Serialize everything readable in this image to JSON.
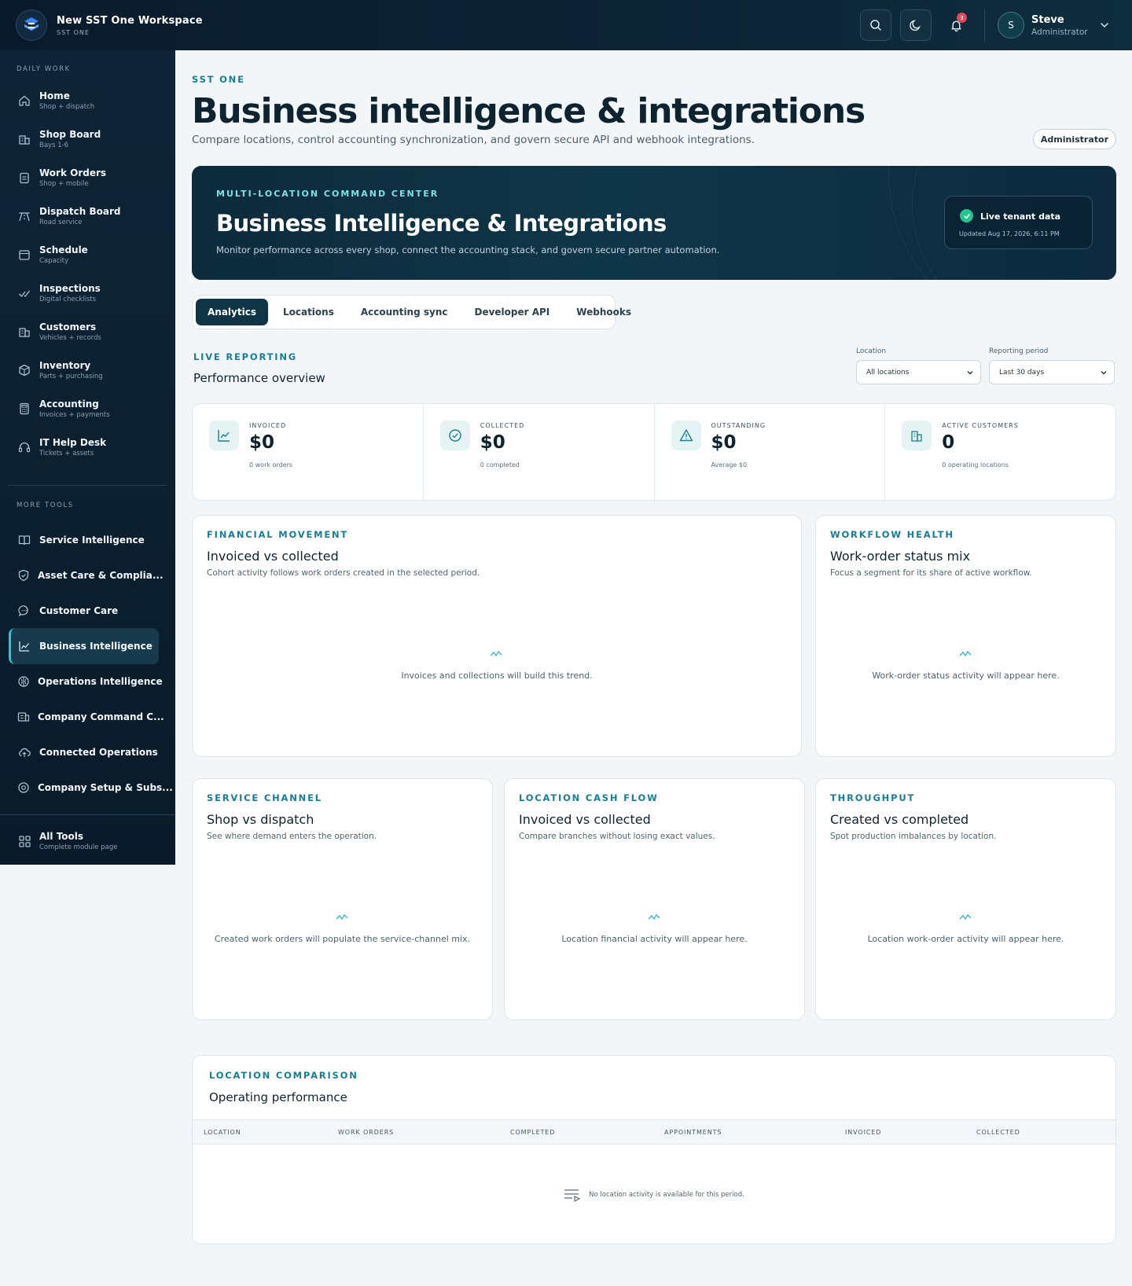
{
  "app": {
    "title": "New SST One Workspace",
    "subtitle": "SST ONE",
    "notifications": "3",
    "user_initial": "S",
    "user_name": "Steve",
    "user_role": "Administrator"
  },
  "sidebar": {
    "daily_label": "DAILY WORK",
    "more_label": "MORE TOOLS",
    "daily": [
      {
        "label": "Home",
        "sub": "Shop + dispatch",
        "icon": "home-icon"
      },
      {
        "label": "Shop Board",
        "sub": "Bays 1-6",
        "icon": "building-icon"
      },
      {
        "label": "Work Orders",
        "sub": "Shop + mobile",
        "icon": "clipboard-icon"
      },
      {
        "label": "Dispatch Board",
        "sub": "Road service",
        "icon": "road-icon"
      },
      {
        "label": "Schedule",
        "sub": "Capacity",
        "icon": "calendar-icon"
      },
      {
        "label": "Inspections",
        "sub": "Digital checklists",
        "icon": "check-icon"
      },
      {
        "label": "Customers",
        "sub": "Vehicles + records",
        "icon": "building-icon"
      },
      {
        "label": "Inventory",
        "sub": "Parts + purchasing",
        "icon": "box-icon"
      },
      {
        "label": "Accounting",
        "sub": "Invoices + payments",
        "icon": "calculator-icon"
      },
      {
        "label": "IT Help Desk",
        "sub": "Tickets + assets",
        "icon": "headset-icon"
      }
    ],
    "more": [
      {
        "label": "Service Intelligence",
        "icon": "book-icon"
      },
      {
        "label": "Asset Care & Complia...",
        "icon": "shield-icon"
      },
      {
        "label": "Customer Care",
        "icon": "chat-icon"
      },
      {
        "label": "Business Intelligence",
        "icon": "chart-icon"
      },
      {
        "label": "Operations Intelligence",
        "icon": "brain-icon"
      },
      {
        "label": "Company Command C...",
        "icon": "command-icon"
      },
      {
        "label": "Connected Operations",
        "icon": "cloud-upload-icon"
      },
      {
        "label": "Company Setup & Subs...",
        "icon": "setup-icon"
      }
    ],
    "all_tools": {
      "label": "All Tools",
      "sub": "Complete module page"
    }
  },
  "page": {
    "eyebrow": "SST ONE",
    "title": "Business intelligence & integrations",
    "subtitle": "Compare locations, control accounting synchronization, and govern secure API and webhook integrations.",
    "role": "Administrator"
  },
  "hero": {
    "eyebrow": "MULTI-LOCATION COMMAND CENTER",
    "title": "Business Intelligence & Integrations",
    "description": "Monitor performance across every shop, connect the accounting stack, and govern secure partner automation.",
    "status_title": "Live tenant data",
    "status_updated": "Updated Aug 17, 2026, 6:11 PM"
  },
  "tabs": [
    "Analytics",
    "Locations",
    "Accounting sync",
    "Developer API",
    "Webhooks"
  ],
  "reporting": {
    "eyebrow": "LIVE REPORTING",
    "title": "Performance overview",
    "location_label": "Location",
    "location_value": "All locations",
    "period_label": "Reporting period",
    "period_value": "Last 30 days"
  },
  "kpis": [
    {
      "label": "INVOICED",
      "value": "$0",
      "note": "0 work orders",
      "icon": "trend-icon"
    },
    {
      "label": "COLLECTED",
      "value": "$0",
      "note": "0 completed",
      "icon": "check-circle-icon"
    },
    {
      "label": "OUTSTANDING",
      "value": "$0",
      "note": "Average $0",
      "icon": "warning-icon"
    },
    {
      "label": "ACTIVE CUSTOMERS",
      "value": "0",
      "note": "0 operating locations",
      "icon": "building-icon"
    }
  ],
  "cards": {
    "financial": {
      "eyebrow": "FINANCIAL MOVEMENT",
      "title": "Invoiced vs collected",
      "sub": "Cohort activity follows work orders created in the selected period.",
      "empty": "Invoices and collections will build this trend."
    },
    "workflow": {
      "eyebrow": "WORKFLOW HEALTH",
      "title": "Work-order status mix",
      "sub": "Focus a segment for its share of active workflow.",
      "empty": "Work-order status activity will appear here."
    },
    "service": {
      "eyebrow": "SERVICE CHANNEL",
      "title": "Shop vs dispatch",
      "sub": "See where demand enters the operation.",
      "empty": "Created work orders will populate the service-channel mix."
    },
    "cashflow": {
      "eyebrow": "LOCATION CASH FLOW",
      "title": "Invoiced vs collected",
      "sub": "Compare branches without losing exact values.",
      "empty": "Location financial activity will appear here."
    },
    "throughput": {
      "eyebrow": "THROUGHPUT",
      "title": "Created vs completed",
      "sub": "Spot production imbalances by location.",
      "empty": "Location work-order activity will appear here."
    }
  },
  "comparison": {
    "eyebrow": "LOCATION COMPARISON",
    "title": "Operating performance",
    "columns": [
      "LOCATION",
      "WORK ORDERS",
      "COMPLETED",
      "APPOINTMENTS",
      "INVOICED",
      "COLLECTED"
    ],
    "empty": "No location activity is available for this period."
  }
}
